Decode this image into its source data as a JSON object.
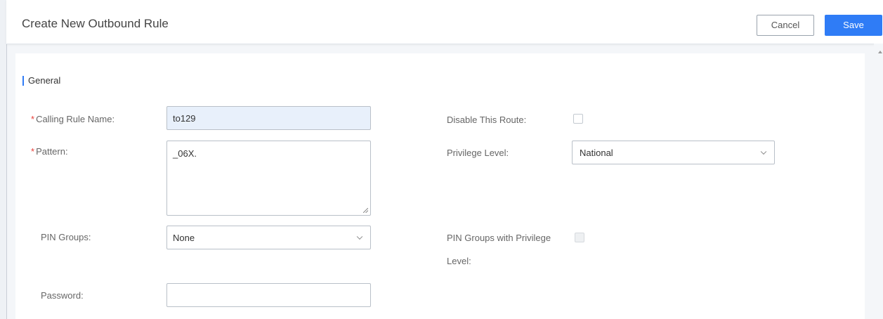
{
  "header": {
    "title": "Create New Outbound Rule",
    "cancel_label": "Cancel",
    "save_label": "Save"
  },
  "section": {
    "title": "General"
  },
  "form": {
    "calling_rule_name": {
      "label": "Calling Rule Name:",
      "value": "to129",
      "required": true
    },
    "pattern": {
      "label": "Pattern:",
      "value": "_06X.",
      "required": true
    },
    "pin_groups": {
      "label": "PIN Groups:",
      "selected": "None"
    },
    "password": {
      "label": "Password:",
      "value": ""
    },
    "disable_route": {
      "label": "Disable This Route:",
      "checked": false
    },
    "privilege_level": {
      "label": "Privilege Level:",
      "selected": "National"
    },
    "pin_groups_privilege": {
      "label_line1": "PIN Groups with Privilege",
      "label_line2": "Level:",
      "checked": false,
      "disabled": true
    }
  },
  "colors": {
    "accent": "#2f7cf6",
    "required": "#e8403a",
    "filled_input": "#e8f0fb"
  }
}
